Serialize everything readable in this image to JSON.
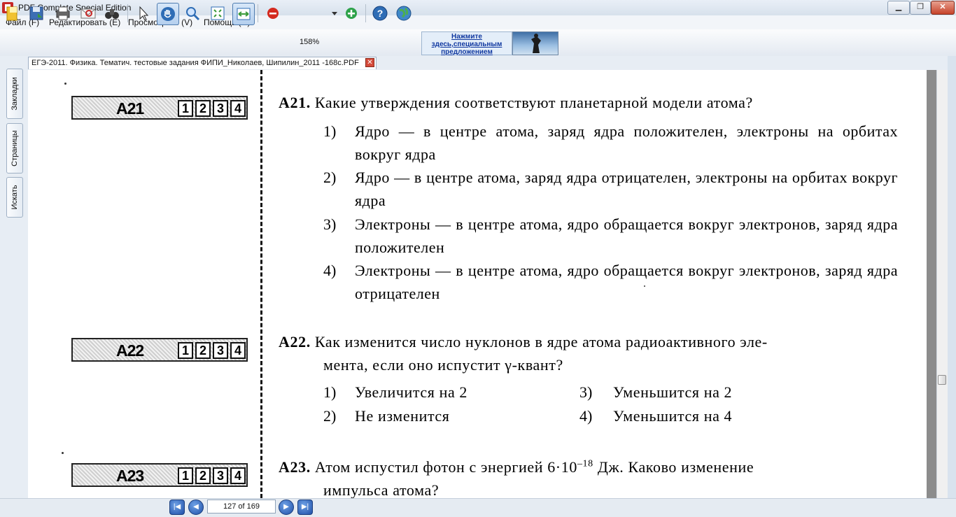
{
  "window": {
    "title": "PDF Complete Special Edition"
  },
  "menu": {
    "items": [
      "Файл (F)",
      "Редактировать (E)",
      "Просмотреть (V)",
      "Помощь (H)"
    ]
  },
  "toolbar": {
    "zoom": "158%",
    "promo_line1": "Нажмите",
    "promo_line2": "здесь,специальным",
    "promo_line3": "предложением",
    "icons": [
      "open-icon",
      "save-icon",
      "print-icon",
      "email-icon",
      "find-icon",
      "select-icon",
      "hand-icon",
      "zoom-icon",
      "fit-page-icon",
      "fit-width-icon",
      "zoom-out-icon",
      "zoom-in-icon",
      "help-icon",
      "globe-icon"
    ]
  },
  "tab": {
    "filename": "ЕГЭ-2011. Физика. Тематич. тестовые задания ФИПИ_Николаев, Шипилин_2011 -168с.PDF"
  },
  "sidebar": {
    "tabs": [
      "Закладки",
      "Страницы",
      "Искать"
    ]
  },
  "document": {
    "boxes": [
      {
        "label": "A21",
        "cells": [
          "1",
          "2",
          "3",
          "4"
        ]
      },
      {
        "label": "A22",
        "cells": [
          "1",
          "2",
          "3",
          "4"
        ]
      },
      {
        "label": "A23",
        "cells": [
          "1",
          "2",
          "3",
          "4"
        ]
      }
    ],
    "q21": {
      "num": "A21.",
      "text": "Какие утверждения соответствуют планетарной модели атома?",
      "options": [
        {
          "n": "1)",
          "t": "Ядро — в центре атома, заряд ядра положителен, электроны на орбитах вокруг ядра"
        },
        {
          "n": "2)",
          "t": "Ядро — в центре атома, заряд ядра отрицателен, электроны на орбитах вокруг ядра"
        },
        {
          "n": "3)",
          "t": "Электроны — в центре атома, ядро обращается вокруг электронов, заряд ядра положителен"
        },
        {
          "n": "4)",
          "t": "Электроны — в центре атома, ядро обращается вокруг электронов, заряд ядра отрицателен"
        }
      ]
    },
    "q22": {
      "num": "A22.",
      "line1": "Как изменится число нуклонов в ядре атома радиоактивного эле-",
      "line2": "мента, если оно испустит γ-квант?",
      "options": [
        {
          "n": "1)",
          "t": "Увеличится на 2"
        },
        {
          "n": "2)",
          "t": "Не изменится"
        },
        {
          "n": "3)",
          "t": "Уменьшится на 2"
        },
        {
          "n": "4)",
          "t": "Уменьшится на 4"
        }
      ]
    },
    "q23": {
      "num": "A23.",
      "line1_a": "Атом испустил фотон с энергией 6·10",
      "line1_exp": "–18",
      "line1_b": " Дж. Каково изменение",
      "line2": "импульса атома?"
    }
  },
  "status": {
    "page_indicator": "127 of 169"
  }
}
